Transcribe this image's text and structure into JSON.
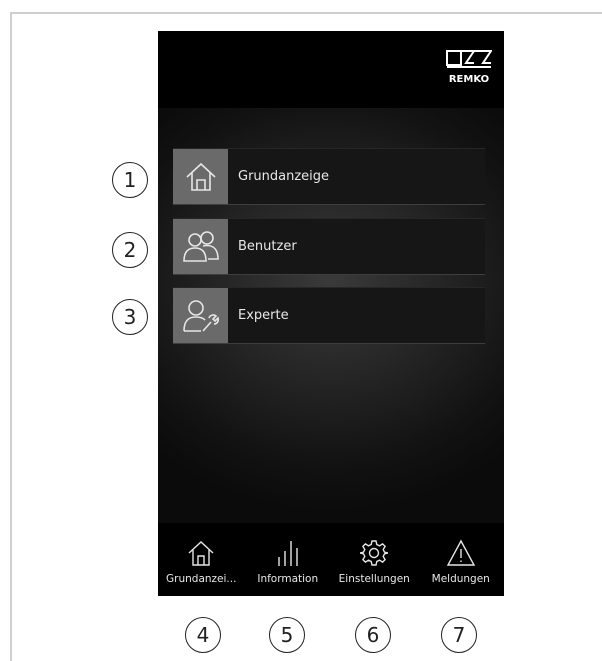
{
  "app": {
    "brand": "REMKO"
  },
  "menu": {
    "items": [
      {
        "label": "Grundanzeige",
        "icon": "home-icon"
      },
      {
        "label": "Benutzer",
        "icon": "users-icon"
      },
      {
        "label": "Experte",
        "icon": "expert-icon"
      }
    ]
  },
  "nav": {
    "items": [
      {
        "label": "Grundanzei...",
        "icon": "home-icon"
      },
      {
        "label": "Information",
        "icon": "bars-icon"
      },
      {
        "label": "Einstellungen",
        "icon": "gear-icon"
      },
      {
        "label": "Meldungen",
        "icon": "warning-icon"
      }
    ]
  },
  "callouts": [
    "1",
    "2",
    "3",
    "4",
    "5",
    "6",
    "7"
  ],
  "colors": {
    "header": "#000000",
    "icon_tile": "#6a6a6a",
    "menu_bg": "#161616",
    "text": "#e8e8e8"
  }
}
